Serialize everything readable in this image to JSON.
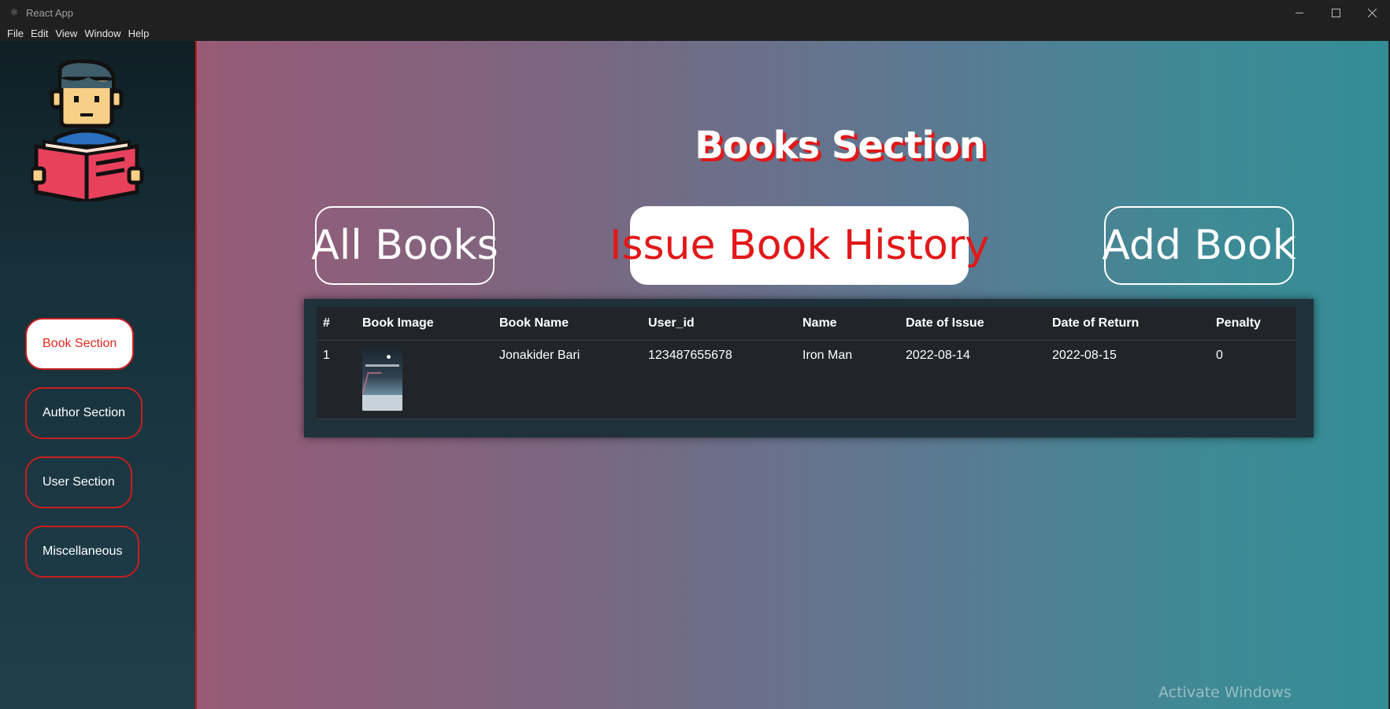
{
  "window": {
    "title": "React App",
    "menu": [
      "File",
      "Edit",
      "View",
      "Window",
      "Help"
    ]
  },
  "sidebar": {
    "items": [
      {
        "label": "Book Section",
        "active": true
      },
      {
        "label": "Author Section",
        "active": false
      },
      {
        "label": "User Section",
        "active": false
      },
      {
        "label": "Miscellaneous",
        "active": false
      }
    ]
  },
  "main": {
    "title": "Books Section",
    "tabs": [
      {
        "label": "All Books",
        "active": false
      },
      {
        "label": "Issue Book History",
        "active": true
      },
      {
        "label": "Add Book",
        "active": false
      }
    ],
    "table": {
      "columns": [
        "#",
        "Book Image",
        "Book Name",
        "User_id",
        "Name",
        "Date of Issue",
        "Date of Return",
        "Penalty"
      ],
      "rows": [
        {
          "index": "1",
          "book_name": "Jonakider Bari",
          "user_id": "123487655678",
          "name": "Iron Man",
          "date_of_issue": "2022-08-14",
          "date_of_return": "2022-08-15",
          "penalty": "0"
        }
      ]
    }
  },
  "os_watermark": "Activate Windows",
  "colors": {
    "accent_red": "#e21818",
    "sidebar_border": "#c81e1e",
    "table_bg": "#212529"
  }
}
